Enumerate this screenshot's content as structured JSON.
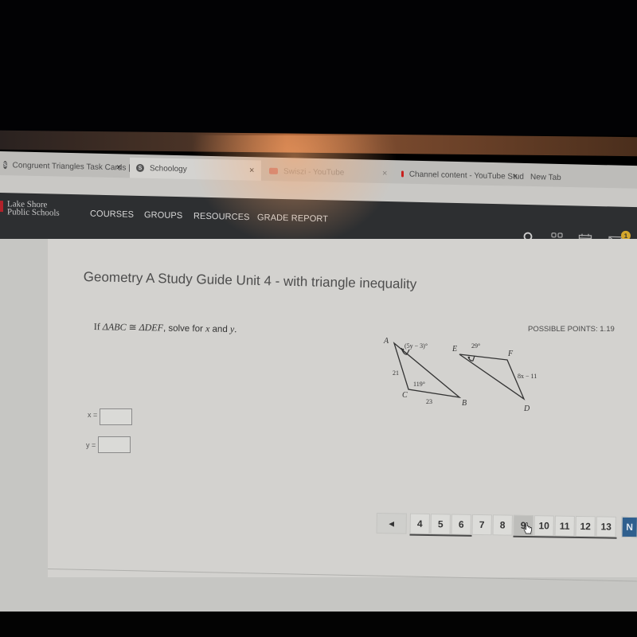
{
  "browser": {
    "tabs": [
      {
        "title": "Congruent Triangles Task Cards |",
        "icon": "schoology-icon",
        "active": false
      },
      {
        "title": "Schoology",
        "icon": "schoology-icon",
        "active": true
      },
      {
        "title": "Swiszi - YouTube",
        "icon": "youtube-icon",
        "active": false
      },
      {
        "title": "Channel content - YouTube Stud",
        "icon": "youtube-icon",
        "active": false
      },
      {
        "title": "New Tab",
        "icon": "",
        "active": false
      }
    ],
    "close_glyph": "×"
  },
  "navbar": {
    "logo_line1": "Lake Shore",
    "logo_line2": "Public Schools",
    "items": [
      "COURSES",
      "GROUPS",
      "RESOURCES",
      "GRADE REPORT"
    ],
    "icons": [
      "search-icon",
      "apps-grid-icon",
      "calendar-icon",
      "mail-icon"
    ],
    "mail_badge": "1"
  },
  "assignment": {
    "title": "Geometry A Study Guide Unit 4 - with triangle inequality",
    "possible_points_label": "POSSIBLE POINTS: 1.19",
    "question": {
      "prefix": "If ",
      "tri1": "ΔABC",
      "congruent": " ≅ ",
      "tri2": "ΔDEF",
      "middle": ", solve for ",
      "var_x": "x",
      "and": " and ",
      "var_y": "y",
      "end": "."
    },
    "answers": [
      {
        "label": "x =",
        "value": ""
      },
      {
        "label": "y =",
        "value": ""
      }
    ]
  },
  "diagram": {
    "triangle1": {
      "vertices": [
        "A",
        "B",
        "C"
      ],
      "angle_A": "(5y − 3)°",
      "side_AC": "21",
      "angle_C": "119°",
      "side_CB": "23"
    },
    "triangle2": {
      "vertices": [
        "E",
        "F",
        "D"
      ],
      "angle_E": "29°",
      "side_FD": "8x − 11"
    }
  },
  "pagination": {
    "prev_glyph": "◀",
    "pages": [
      "4",
      "5",
      "6",
      "7",
      "8",
      "9",
      "10",
      "11",
      "12",
      "13"
    ],
    "current": "9",
    "next_label": "N"
  }
}
